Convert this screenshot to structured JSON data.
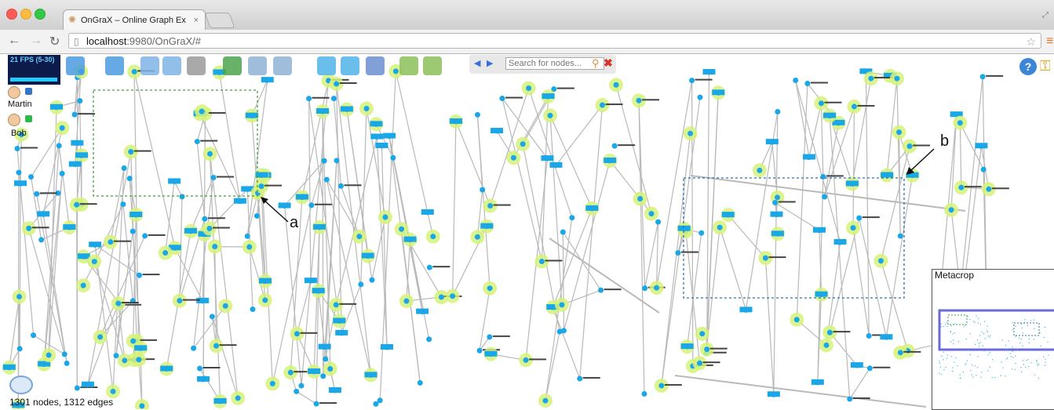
{
  "browser": {
    "tab_title": "OnGraX – Online Graph Ex",
    "tab_close": "×",
    "url_host": "localhost",
    "url_rest": ":9980/OnGraX/#"
  },
  "app": {
    "fps": "21 FPS (5-30)",
    "users": [
      {
        "name": "Martin",
        "color": "#3575c9"
      },
      {
        "name": "Bob",
        "color": "#2db84a"
      }
    ],
    "search_placeholder": "Search for nodes...",
    "status": "1301 nodes, 1312 edges",
    "help": "?",
    "metacrop_label": "Metacrop",
    "callouts": {
      "a": "a",
      "b": "b"
    },
    "toolbar": [
      {
        "name": "add-view-icon"
      },
      {
        "name": "remove-view-icon"
      },
      {
        "name": "zoom-in-icon"
      },
      {
        "name": "zoom-out-icon"
      },
      {
        "name": "home-view-icon"
      },
      {
        "name": "layout-icon"
      },
      {
        "name": "edit-icon"
      },
      {
        "name": "list-icon"
      },
      {
        "name": "add-node-icon"
      },
      {
        "name": "remove-node-icon"
      },
      {
        "name": "tool-icon"
      },
      {
        "name": "add-edge-icon"
      },
      {
        "name": "remove-edge-icon"
      }
    ]
  },
  "colors": {
    "node": "#1aa7e8",
    "halo": "#d6f27a",
    "edge": "#b9b9b9",
    "selection_a": "#3aa33a",
    "selection_b": "#2a6fb3"
  }
}
